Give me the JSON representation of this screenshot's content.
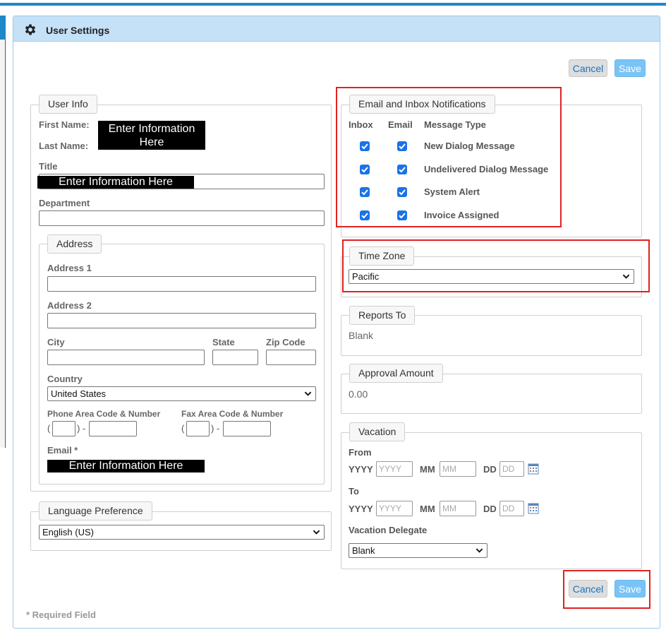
{
  "dialog": {
    "title": "User Settings",
    "cancel_label": "Cancel",
    "save_label": "Save"
  },
  "user_info": {
    "legend": "User Info",
    "first_name_label": "First Name:",
    "last_name_label": "Last Name:",
    "name_value": "Enter Information\nHere",
    "title_label": "Title",
    "title_value": "Enter Information Here",
    "department_label": "Department",
    "address": {
      "legend": "Address",
      "address1_label": "Address 1",
      "address2_label": "Address 2",
      "city_label": "City",
      "state_label": "State",
      "zip_label": "Zip Code",
      "country_label": "Country",
      "country_value": "United States",
      "phone_label": "Phone Area Code & Number",
      "fax_label": "Fax Area Code & Number",
      "email_label": "Email  *",
      "email_value": "Enter Information Here"
    }
  },
  "language": {
    "legend": "Language Preference",
    "value": "English (US)"
  },
  "notifications": {
    "legend": "Email and Inbox Notifications",
    "col_inbox": "Inbox",
    "col_email": "Email",
    "col_type": "Message Type",
    "rows": [
      {
        "type": "New Dialog Message",
        "inbox": true,
        "email": true
      },
      {
        "type": "Undelivered Dialog Message",
        "inbox": true,
        "email": true
      },
      {
        "type": "System Alert",
        "inbox": true,
        "email": true
      },
      {
        "type": "Invoice Assigned",
        "inbox": true,
        "email": true
      }
    ]
  },
  "time_zone": {
    "legend": "Time Zone",
    "value": "Pacific"
  },
  "reports_to": {
    "legend": "Reports To",
    "value": "Blank"
  },
  "approval_amount": {
    "legend": "Approval Amount",
    "value": "0.00"
  },
  "vacation": {
    "legend": "Vacation",
    "from_label": "From",
    "to_label": "To",
    "yyyy_label": "YYYY",
    "mm_label": "MM",
    "dd_label": "DD",
    "yyyy_placeholder": "YYYY",
    "mm_placeholder": "MM",
    "dd_placeholder": "DD",
    "delegate_label": "Vacation Delegate",
    "delegate_value": "Blank"
  },
  "footer": {
    "required_note": "* Required Field"
  },
  "colors": {
    "accent": "#1e88c8",
    "title_bar": "#c4e1f8",
    "save_button": "#79c3f6",
    "checkbox": "#1a73e8",
    "highlight_box": "#e02222"
  }
}
